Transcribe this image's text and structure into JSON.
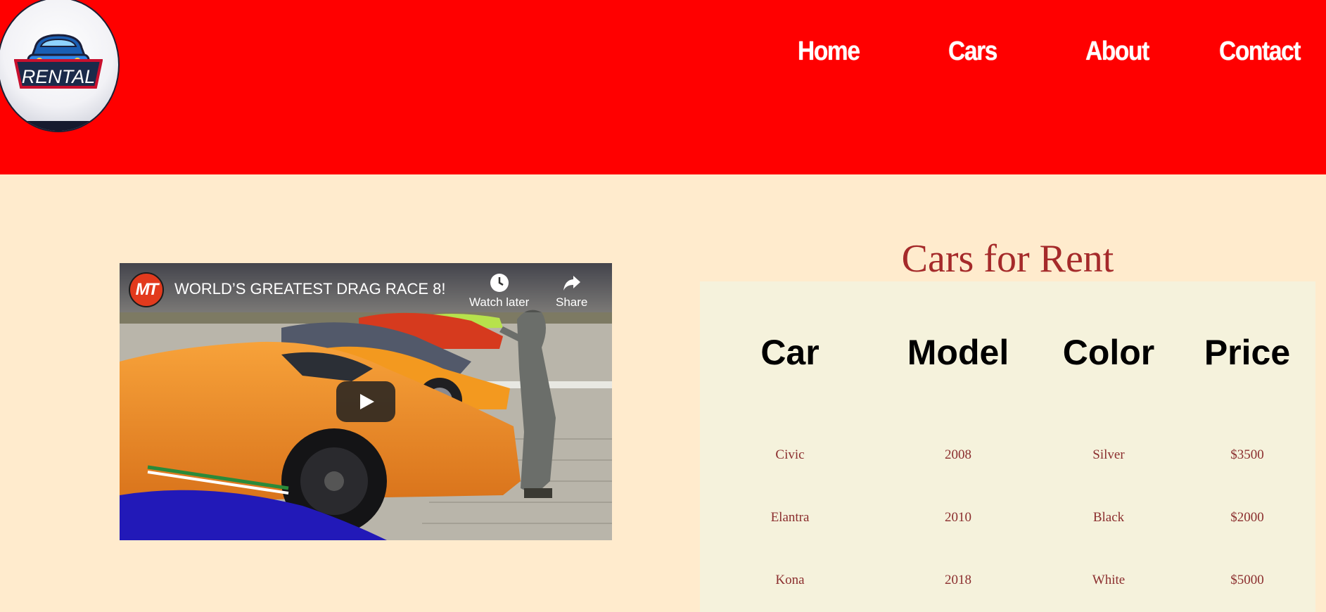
{
  "header": {
    "logo_text": "RENTAL",
    "nav": [
      {
        "label": "Home"
      },
      {
        "label": "Cars"
      },
      {
        "label": "About"
      },
      {
        "label": "Contact"
      }
    ]
  },
  "video": {
    "channel": "MT",
    "title": "WORLD’S GREATEST DRAG RACE 8!",
    "watch_later": "Watch later",
    "share": "Share",
    "play_icon": "play-icon"
  },
  "cars_table": {
    "title": "Cars for Rent",
    "headers": [
      "Car",
      "Model",
      "Color",
      "Price"
    ],
    "rows": [
      [
        "Civic",
        "2008",
        "Silver",
        "$3500"
      ],
      [
        "Elantra",
        "2010",
        "Black",
        "$2000"
      ],
      [
        "Kona",
        "2018",
        "White",
        "$5000"
      ]
    ]
  },
  "colors": {
    "header_bg": "#ff0000",
    "page_bg": "#ffebcd",
    "table_bg": "#f5f2dc",
    "title_color": "#a52a2a",
    "cell_color": "#8b2e2e"
  }
}
